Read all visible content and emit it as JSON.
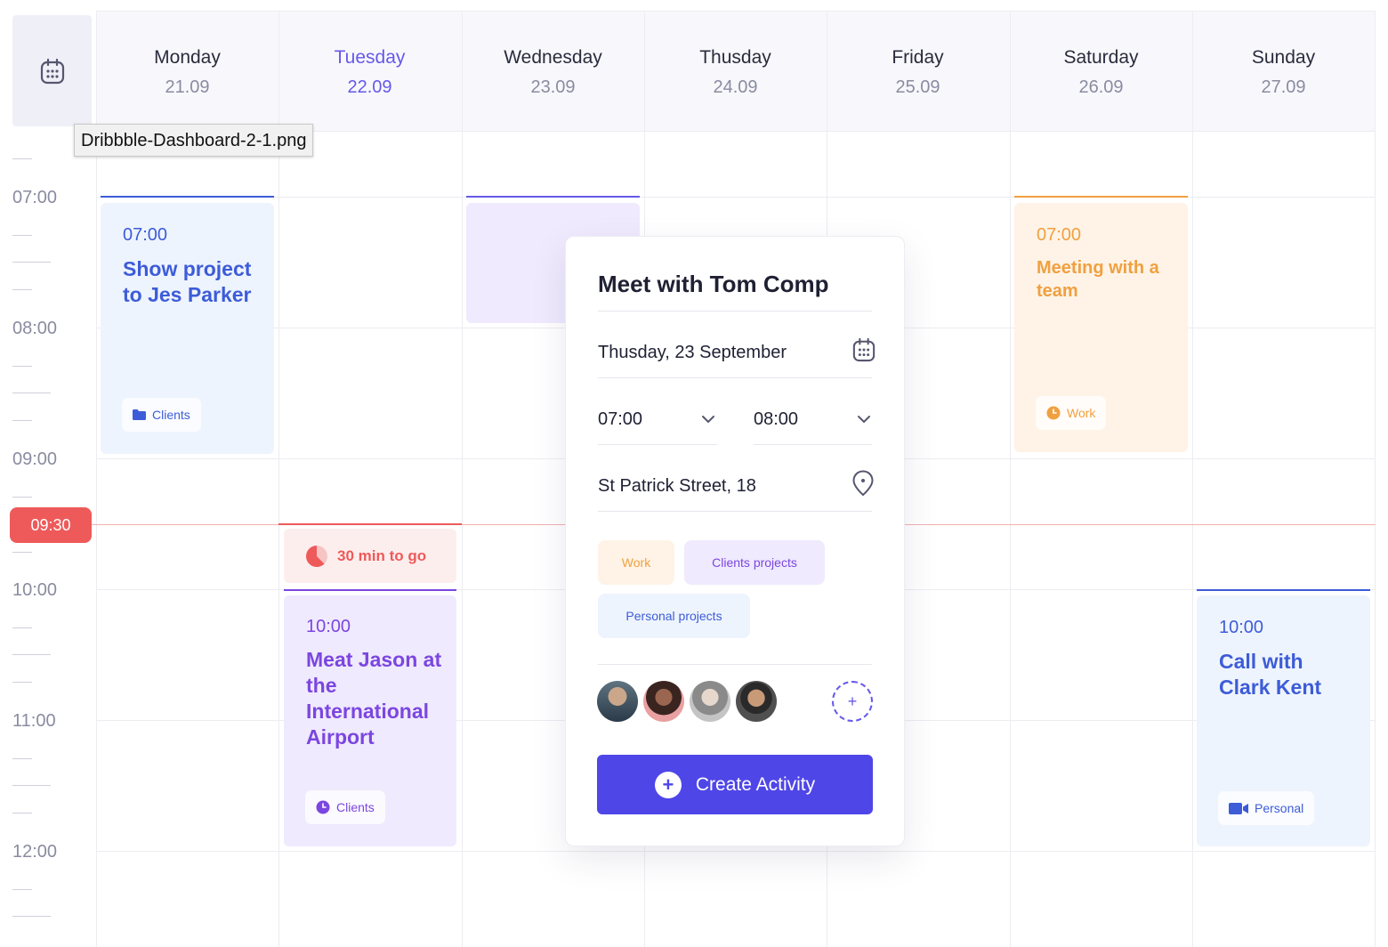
{
  "tooltip": "Dribbble-Dashboard-2-1.png",
  "days": [
    {
      "name": "Monday",
      "date": "21.09"
    },
    {
      "name": "Tuesday",
      "date": "22.09"
    },
    {
      "name": "Wednesday",
      "date": "23.09"
    },
    {
      "name": "Thusday",
      "date": "24.09"
    },
    {
      "name": "Friday",
      "date": "25.09"
    },
    {
      "name": "Saturday",
      "date": "26.09"
    },
    {
      "name": "Sunday",
      "date": "27.09"
    }
  ],
  "active_day": "Tuesday",
  "times": [
    "07:00",
    "08:00",
    "09:00",
    "10:00",
    "11:00",
    "12:00"
  ],
  "now": "09:30",
  "events": {
    "monday": {
      "time": "07:00",
      "title": "Show project to Jes Parker",
      "tag": "Clients"
    },
    "saturday": {
      "time": "07:00",
      "title": "Meeting with a team",
      "tag": "Work"
    },
    "tuesday_countdown": "30 min to go",
    "tuesday": {
      "time": "10:00",
      "title": "Meat Jason at the International Airport",
      "tag": "Clients"
    },
    "sunday": {
      "time": "10:00",
      "title": "Call with Clark Kent",
      "tag": "Personal"
    }
  },
  "popup": {
    "title": "Meet with Tom Comp",
    "date": "Thusday, 23 September",
    "start_time": "07:00",
    "end_time": "08:00",
    "location": "St Patrick Street, 18",
    "tags": [
      "Work",
      "Clients projects",
      "Personal projects"
    ],
    "create_label": "Create Activity"
  },
  "colors": {
    "accent": "#4f46e8",
    "blue_event_bg": "#eef4fd",
    "blue_event_text": "#3d5cd8",
    "orange_event_bg": "#fef3e6",
    "orange_event_text": "#f0a040",
    "purple_event_bg": "#efeafd",
    "purple_event_text": "#7b46e0",
    "now_red": "#ee5a5a"
  }
}
